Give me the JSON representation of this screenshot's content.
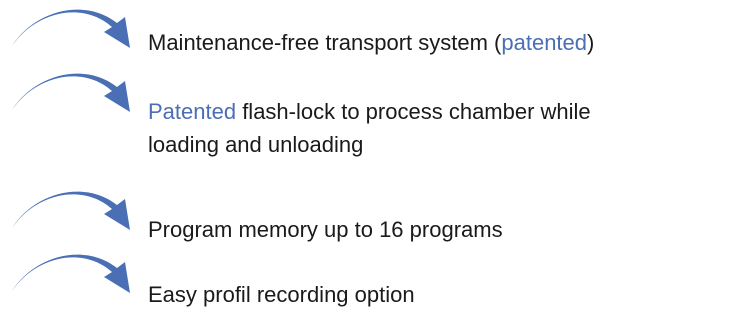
{
  "colors": {
    "arrow": "#4a6fb5",
    "highlight": "#4a6fb5",
    "text": "#1a1a1a"
  },
  "icons": {
    "bullet": "curved-arrow-icon"
  },
  "features": [
    {
      "pre": "Maintenance-free transport system (",
      "highlight": "patented",
      "post": ")"
    },
    {
      "highlight": "Patented",
      "line1_rest": " flash-lock to process chamber while",
      "line2": "loading and unloading"
    },
    {
      "text": "Program memory up to 16 programs"
    },
    {
      "text": "Easy profil recording option"
    }
  ]
}
